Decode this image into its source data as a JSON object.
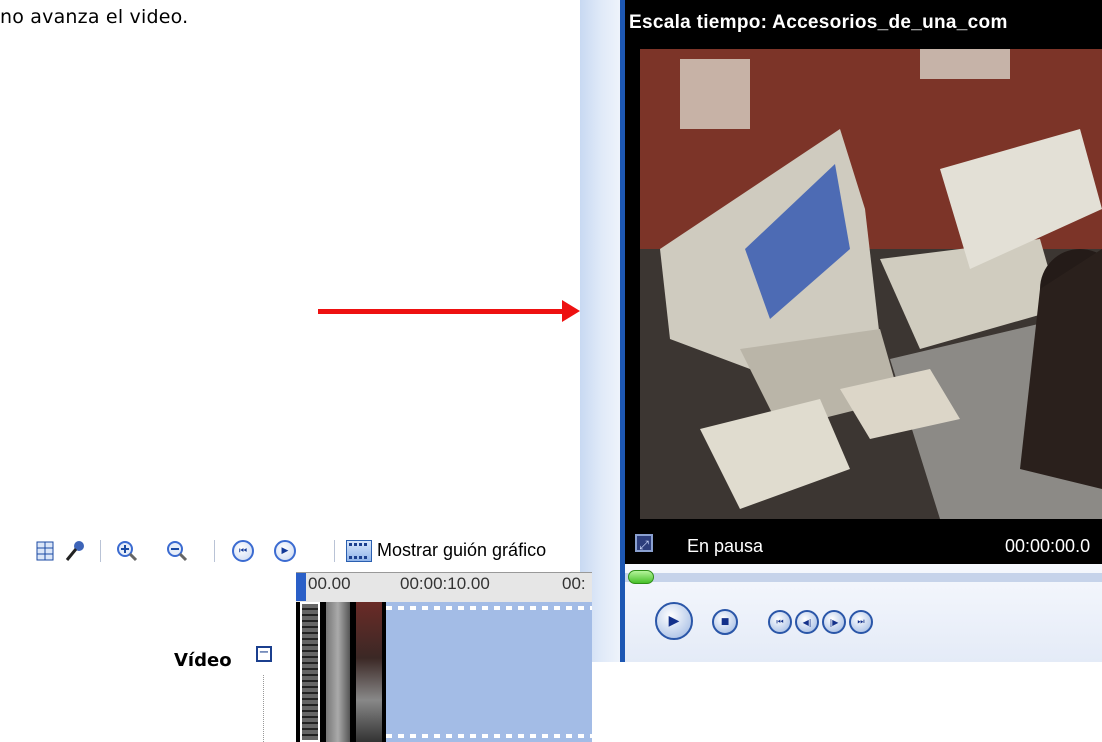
{
  "caption": "no avanza el video.",
  "ellipsis": "...",
  "player": {
    "title": "Escala tiempo: Accesorios_de_una_com",
    "status": "En pausa",
    "time": "00:00:00.0",
    "seek_fraction": 0.0
  },
  "toolbar": {
    "storyboard_label": "Mostrar guión gráfico"
  },
  "timeline": {
    "ruler_labels": [
      "00.00",
      "00:00:10.00",
      "00:"
    ],
    "track_label": "Vídeo"
  },
  "colors": {
    "arrow": "#ee1111",
    "player_frame": "#1d57b3",
    "clip_empty": "#a3bce6"
  },
  "icons": [
    "narrate-timeline-icon",
    "audio-levels-icon",
    "zoom-in-icon",
    "zoom-out-icon",
    "rewind-icon",
    "play-timeline-icon",
    "storyboard-icon"
  ]
}
